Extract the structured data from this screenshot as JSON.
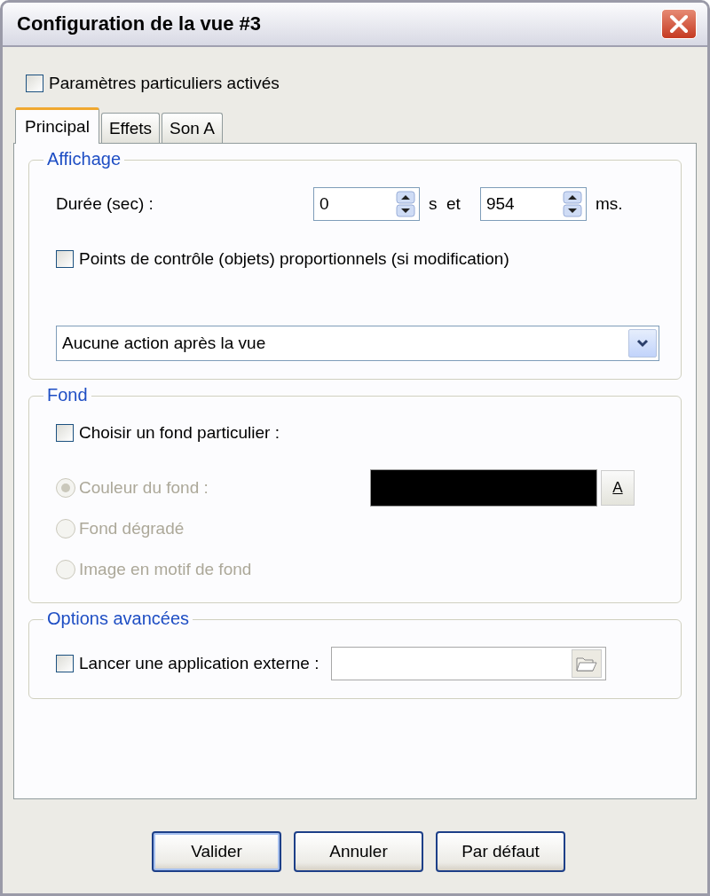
{
  "window": {
    "title": "Configuration de la vue #3"
  },
  "custom_settings": {
    "label": "Paramètres particuliers activés",
    "checked": false
  },
  "tabs": [
    {
      "label": "Principal",
      "selected": true
    },
    {
      "label": "Effets",
      "selected": false
    },
    {
      "label": "Son A",
      "selected": false
    }
  ],
  "display": {
    "title": "Affichage",
    "duration_label": "Durée (sec) :",
    "seconds": "0",
    "seconds_unit": "s  et",
    "milliseconds": "954",
    "milliseconds_unit": "ms.",
    "proportional": {
      "label": "Points de contrôle (objets) proportionnels (si modification)",
      "checked": false
    },
    "after_action": "Aucune action après la vue"
  },
  "background": {
    "title": "Fond",
    "custom": {
      "label": "Choisir un fond particulier :",
      "checked": false
    },
    "options": [
      {
        "label": "Couleur du fond :",
        "selected": true,
        "disabled": true
      },
      {
        "label": "Fond dégradé",
        "selected": false,
        "disabled": true
      },
      {
        "label": "Image en motif de fond",
        "selected": false,
        "disabled": true
      }
    ],
    "color": "#000000",
    "color_button": "A"
  },
  "advanced": {
    "title": "Options avancées",
    "launch": {
      "label": "Lancer une application externe :",
      "checked": false
    }
  },
  "buttons": [
    {
      "label": "Valider",
      "default": true
    },
    {
      "label": "Annuler",
      "default": false
    },
    {
      "label": "Par défaut",
      "default": false
    }
  ]
}
